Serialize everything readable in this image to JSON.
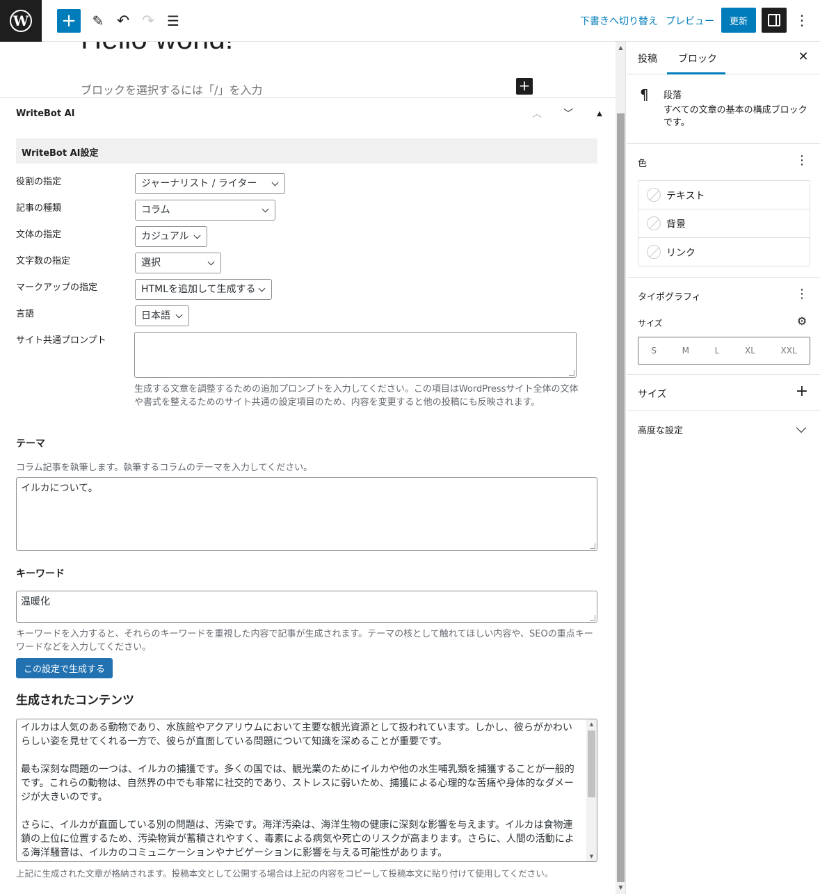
{
  "toolbar": {
    "logo": "W",
    "add_icon": "+",
    "edit_icon": "✎",
    "undo_icon": "↶",
    "redo_icon": "↷",
    "list_icon": "☰",
    "draft_label": "下書きへ切り替え",
    "preview_label": "プレビュー",
    "update_label": "更新",
    "more_icon": "⋮"
  },
  "editor": {
    "post_title": "Hello world!",
    "paragraph_placeholder": "ブロックを選択するには「/」を入力",
    "inline_add_icon": "+"
  },
  "metabox": {
    "title": "WriteBot AI",
    "settings_title": "WriteBot AI設定",
    "fields": [
      {
        "label": "役割の指定",
        "value": "ジャーナリスト / ライター"
      },
      {
        "label": "記事の種類",
        "value": "コラム"
      },
      {
        "label": "文体の指定",
        "value": "カジュアル"
      },
      {
        "label": "文字数の指定",
        "value": "選択"
      },
      {
        "label": "マークアップの指定",
        "value": "HTMLを追加して生成する"
      },
      {
        "label": "言語",
        "value": "日本語"
      }
    ],
    "site_prompt": {
      "label": "サイト共通プロンプト",
      "value": "",
      "description": "生成する文章を調整するための追加プロンプトを入力してください。この項目はWordPressサイト全体の文体や書式を整えるためのサイト共通の設定項目のため、内容を変更すると他の投稿にも反映されます。"
    },
    "theme": {
      "heading": "テーマ",
      "description": "コラム記事を執筆します。執筆するコラムのテーマを入力してください。",
      "value": "イルカについて。"
    },
    "keyword": {
      "heading": "キーワード",
      "value": "温暖化",
      "description": "キーワードを入力すると、それらのキーワードを重視した内容で記事が生成されます。テーマの核として触れてほしい内容や、SEOの重点キーワードなどを入力してください。"
    },
    "generate_button": "この設定で生成する",
    "generated": {
      "heading": "生成されたコンテンツ",
      "paragraphs": [
        "イルカは人気のある動物であり、水族館やアクアリウムにおいて主要な観光資源として扱われています。しかし、彼らがかわいらしい姿を見せてくれる一方で、彼らが直面している問題について知識を深めることが重要です。",
        "最も深刻な問題の一つは、イルカの捕獲です。多くの国では、観光業のためにイルカや他の水生哺乳類を捕獲することが一般的です。これらの動物は、自然界の中でも非常に社交的であり、ストレスに弱いため、捕獲による心理的な苦痛や身体的なダメージが大きいのです。",
        "さらに、イルカが直面している別の問題は、汚染です。海洋汚染は、海洋生物の健康に深刻な影響を与えます。イルカは食物連鎖の上位に位置するため、汚染物質が蓄積されやすく、毒素による病気や死亡のリスクが高まります。さらに、人間の活動による海洋騒音は、イルカのコミュニケーションやナビゲーションに影響を与える可能性があります。"
      ],
      "note": "上記に生成された文章が格納されます。投稿本文として公開する場合は上記の内容をコピーして投稿本文に貼り付けて使用してください。"
    }
  },
  "sidebar": {
    "tabs": [
      "投稿",
      "ブロック"
    ],
    "active_tab": "ブロック",
    "close_icon": "✕",
    "block": {
      "icon": "¶",
      "name": "段落",
      "description": "すべての文章の基本の構成ブロックです。"
    },
    "color": {
      "heading": "色",
      "items": [
        "テキスト",
        "背景",
        "リンク"
      ]
    },
    "typography": {
      "heading": "タイポグラフィ",
      "size_label": "サイズ",
      "sizes": [
        "S",
        "M",
        "L",
        "XL",
        "XXL"
      ]
    },
    "dimensions": {
      "heading": "サイズ"
    },
    "advanced": {
      "heading": "高度な設定"
    }
  }
}
